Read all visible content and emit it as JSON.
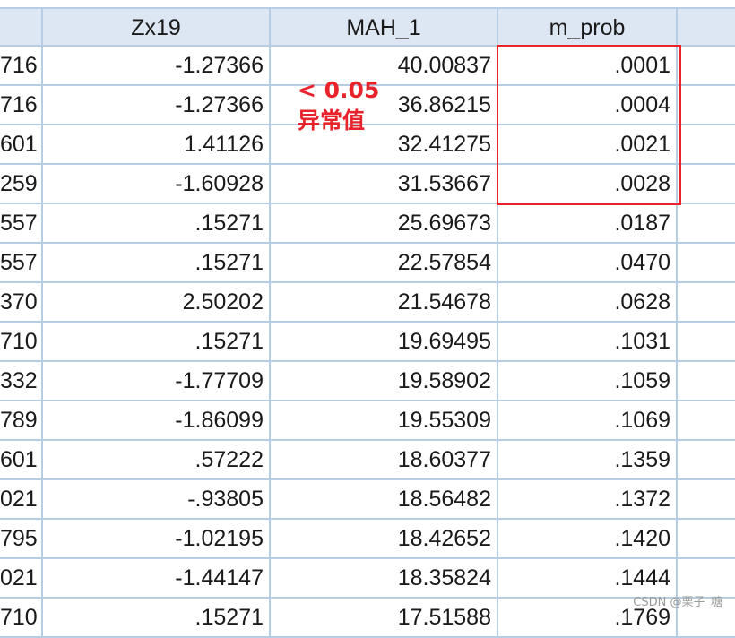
{
  "columns": [
    "",
    "Zx19",
    "MAH_1",
    "m_prob",
    ""
  ],
  "rows": [
    [
      "716",
      "-1.27366",
      "40.00837",
      ".0001"
    ],
    [
      "716",
      "-1.27366",
      "36.86215",
      ".0004"
    ],
    [
      "601",
      "1.41126",
      "32.41275",
      ".0021"
    ],
    [
      "259",
      "-1.60928",
      "31.53667",
      ".0028"
    ],
    [
      "557",
      ".15271",
      "25.69673",
      ".0187"
    ],
    [
      "557",
      ".15271",
      "22.57854",
      ".0470"
    ],
    [
      "370",
      "2.50202",
      "21.54678",
      ".0628"
    ],
    [
      "710",
      ".15271",
      "19.69495",
      ".1031"
    ],
    [
      "332",
      "-1.77709",
      "19.58902",
      ".1059"
    ],
    [
      "789",
      "-1.86099",
      "19.55309",
      ".1069"
    ],
    [
      "601",
      ".57222",
      "18.60377",
      ".1359"
    ],
    [
      "021",
      "-.93805",
      "18.56482",
      ".1372"
    ],
    [
      "795",
      "-1.02195",
      "18.42652",
      ".1420"
    ],
    [
      "021",
      "-1.44147",
      "18.35824",
      ".1444"
    ],
    [
      "710",
      ".15271",
      "17.51588",
      ".1769"
    ]
  ],
  "annotation": {
    "line1": "< 0.05",
    "line2": "异常值",
    "color": "#e8232b"
  },
  "watermark": "CSDN @栗子_糖",
  "colors": {
    "header_bg": "#dde7f3",
    "grid_line": "#b7cde3",
    "highlight": "#e8232b"
  }
}
